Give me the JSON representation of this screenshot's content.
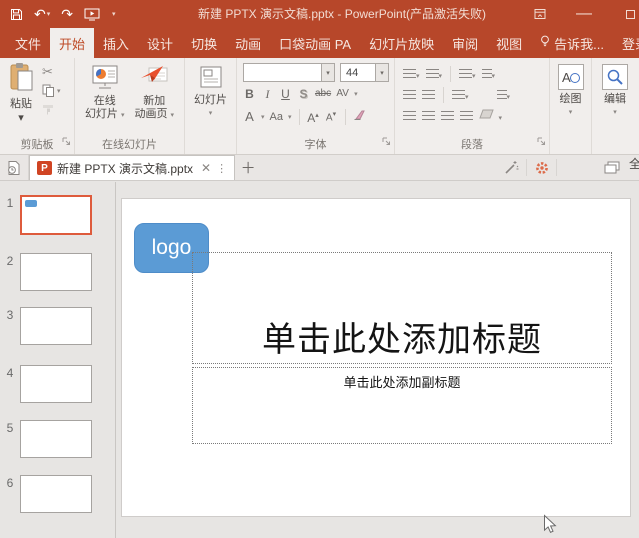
{
  "window": {
    "title": "新建 PPTX 演示文稿.pptx - PowerPoint(产品激活失败)"
  },
  "menu_tabs": [
    {
      "label": "文件"
    },
    {
      "label": "开始"
    },
    {
      "label": "插入"
    },
    {
      "label": "设计"
    },
    {
      "label": "切换"
    },
    {
      "label": "动画"
    },
    {
      "label": "口袋动画 PA"
    },
    {
      "label": "幻灯片放映"
    },
    {
      "label": "审阅"
    },
    {
      "label": "视图"
    },
    {
      "label": "告诉我..."
    },
    {
      "label": "登录"
    }
  ],
  "ribbon": {
    "clipboard": {
      "paste": "粘贴",
      "label": "剪贴板"
    },
    "online": {
      "b1_line1": "在线",
      "b1_line2": "幻灯片",
      "b2_line1": "新加",
      "b2_line2": "动画页",
      "label": "在线幻灯片"
    },
    "slide_btn": {
      "label": "幻灯片"
    },
    "font": {
      "label": "字体",
      "size": "44",
      "bold": "B",
      "italic": "I",
      "underline": "U",
      "shadow": "S",
      "strike": "abc",
      "spacing": "AV",
      "color": "A",
      "case": "Aa",
      "grow": "A",
      "shrink": "A"
    },
    "paragraph": {
      "label": "段落"
    },
    "draw": {
      "label": "绘图"
    },
    "edit": {
      "label": "编辑"
    }
  },
  "doc_tabs": {
    "active": "新建 PPTX 演示文稿.pptx",
    "clipped": "全"
  },
  "slides": [
    "1",
    "2",
    "3",
    "4",
    "5",
    "6"
  ],
  "slide_canvas": {
    "logo": "logo",
    "title": "单击此处添加标题",
    "subtitle": "单击此处添加副标题"
  },
  "colors": {
    "brand": "#B7472A",
    "accent_blue": "#5B9BD5",
    "selection": "#DE5B3C",
    "gear": "#DD6B4A"
  }
}
